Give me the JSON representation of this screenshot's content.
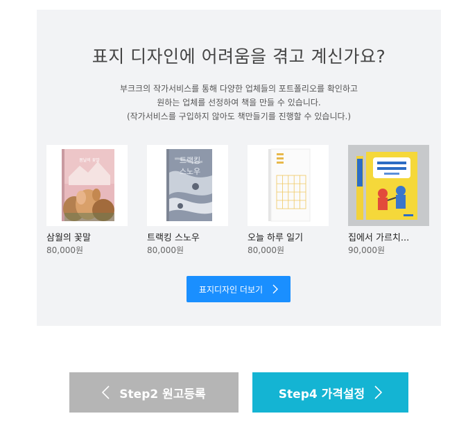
{
  "panel": {
    "title": "표지 디자인에 어려움을 겪고 계신가요?",
    "desc_line1": "부크크의 작가서비스를 통해 다양한 업체들의 포트폴리오를 확인하고",
    "desc_line2": "원하는 업체를 선정하여 책을 만들 수 있습니다.",
    "desc_line3": "(작가서비스를 구입하지 않아도 책만들기를 진행할 수 있습니다.)"
  },
  "books": [
    {
      "title": "삼월의 꽃말",
      "price": "80,000원",
      "cover_text": "봄날의 꽃말"
    },
    {
      "title": "트랙킹 스노우",
      "price": "80,000원",
      "cover_text_1": "트랙킹",
      "cover_text_2": "스노우"
    },
    {
      "title": "오늘 하루 일기",
      "price": "80,000원"
    },
    {
      "title": "집에서 가르치...",
      "price": "90,000원"
    }
  ],
  "more_button": {
    "label": "표지디자인 더보기"
  },
  "steps": {
    "prev_label": "Step2 원고등록",
    "next_label": "Step4 가격설정"
  },
  "colors": {
    "panel_bg": "#f2f3f5",
    "more_button": "#1a8fff",
    "prev_button": "#b5b5b5",
    "next_button": "#14b4d3"
  }
}
